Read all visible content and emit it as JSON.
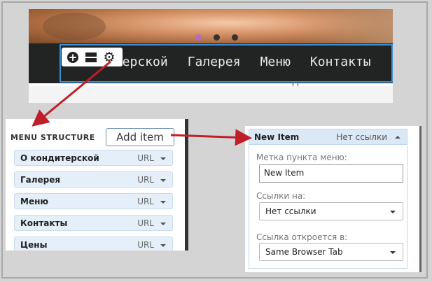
{
  "preview": {
    "nav_items": [
      "О кондитерской",
      "Галерея",
      "Меню",
      "Контакты"
    ],
    "visible_nav_fragment": "итерской",
    "active_slide": 1,
    "slide_count": 3,
    "toolbar_icons": [
      "add-icon",
      "layout-icon",
      "gear-icon"
    ]
  },
  "menu_structure": {
    "title": "MENU STRUCTURE",
    "add_button": "Add item",
    "items": [
      {
        "label": "О кондитерской",
        "link_type": "URL"
      },
      {
        "label": "Галерея",
        "link_type": "URL"
      },
      {
        "label": "Меню",
        "link_type": "URL"
      },
      {
        "label": "Контакты",
        "link_type": "URL"
      },
      {
        "label": "Цены",
        "link_type": "URL"
      }
    ]
  },
  "new_item": {
    "title": "New Item",
    "status": "Нет ссылки",
    "label_field_label": "Метка пункта меню:",
    "label_value": "New Item",
    "link_field_label": "Ссылки на:",
    "link_value": "Нет ссылки",
    "target_field_label": "Ссылка откроется в:",
    "target_value": "Same Browser Tab"
  },
  "colors": {
    "arrow": "#c01f2a",
    "selection": "#3b8fd6",
    "active_dot": "#b46ac9",
    "row_bg": "#e4effa"
  }
}
